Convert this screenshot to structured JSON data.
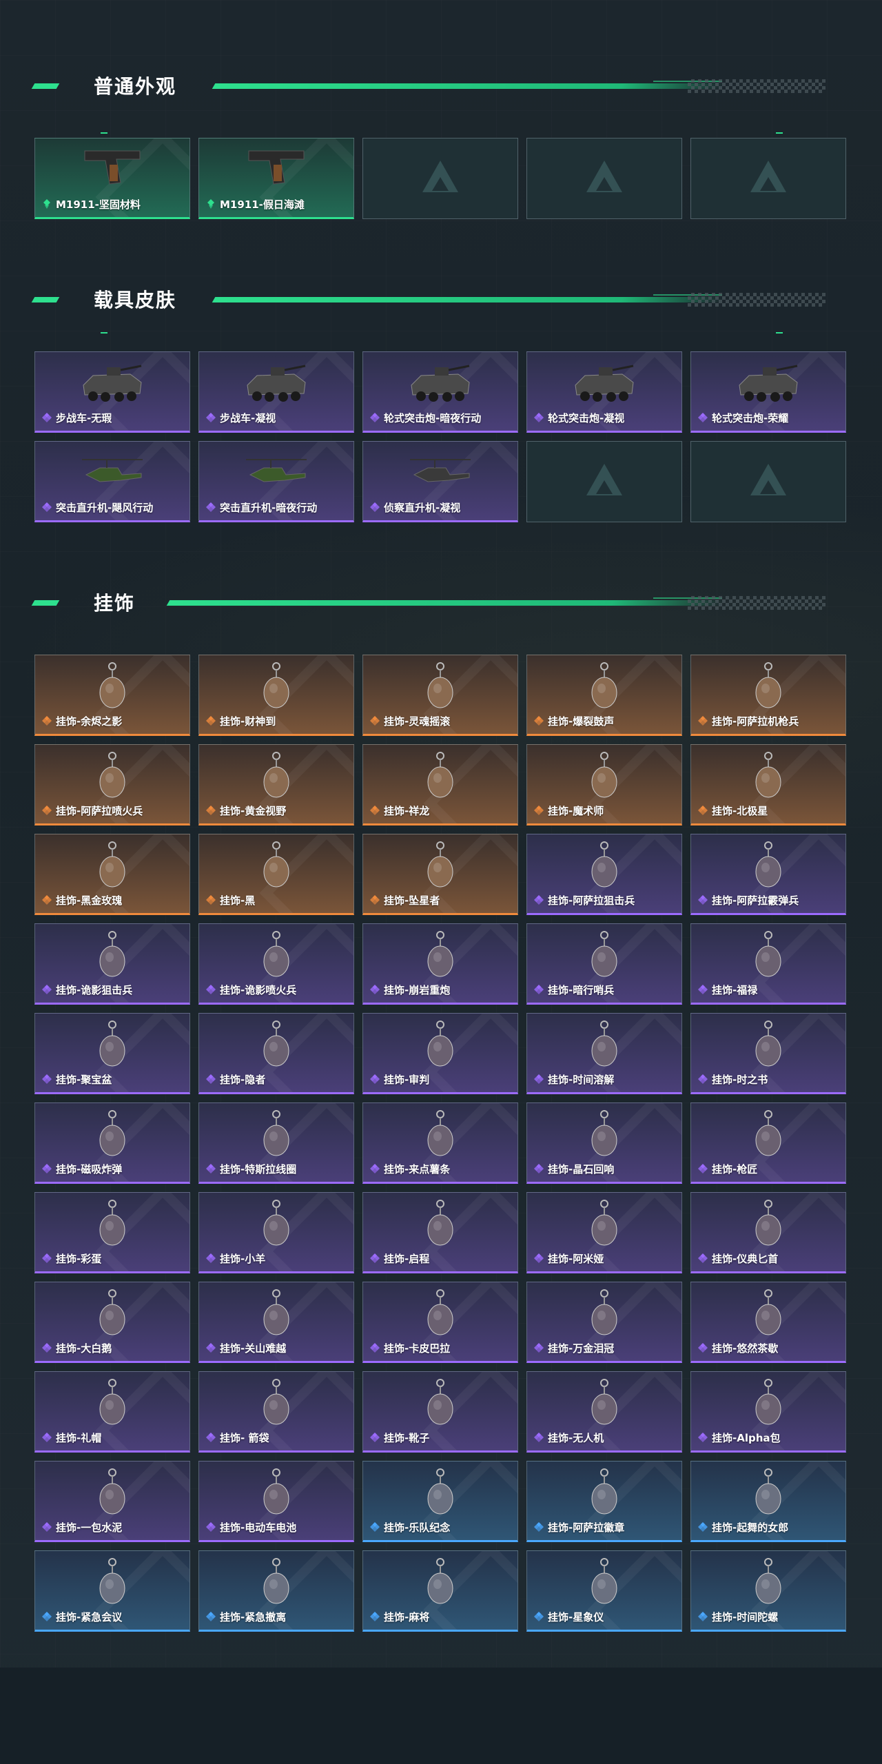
{
  "sections": [
    {
      "title": "普通外观",
      "items": [
        {
          "label": "M1911-坚固材料",
          "rarity": "green",
          "icon": "pistol-icon"
        },
        {
          "label": "M1911-假日海滩",
          "rarity": "green",
          "icon": "pistol-icon"
        },
        {
          "label": "",
          "rarity": "empty",
          "icon": "empty-slot-logo"
        },
        {
          "label": "",
          "rarity": "empty",
          "icon": "empty-slot-logo"
        },
        {
          "label": "",
          "rarity": "empty",
          "icon": "empty-slot-logo"
        }
      ]
    },
    {
      "title": "载具皮肤",
      "items": [
        {
          "label": "步战车-无瑕",
          "rarity": "purple",
          "icon": "ifv-icon"
        },
        {
          "label": "步战车-凝视",
          "rarity": "purple",
          "icon": "ifv-icon"
        },
        {
          "label": "轮式突击炮-暗夜行动",
          "rarity": "purple",
          "icon": "assault-gun-icon"
        },
        {
          "label": "轮式突击炮-凝视",
          "rarity": "purple",
          "icon": "assault-gun-icon"
        },
        {
          "label": "轮式突击炮-荣耀",
          "rarity": "purple",
          "icon": "assault-gun-icon"
        },
        {
          "label": "突击直升机-飓风行动",
          "rarity": "purple",
          "icon": "attack-helicopter-icon"
        },
        {
          "label": "突击直升机-暗夜行动",
          "rarity": "purple",
          "icon": "attack-helicopter-icon"
        },
        {
          "label": "侦察直升机-凝视",
          "rarity": "purple",
          "icon": "scout-helicopter-icon"
        },
        {
          "label": "",
          "rarity": "empty",
          "icon": "empty-slot-logo"
        },
        {
          "label": "",
          "rarity": "empty",
          "icon": "empty-slot-logo"
        }
      ]
    },
    {
      "title": "挂饰",
      "items": [
        {
          "label": "挂饰-余烬之影",
          "rarity": "orange",
          "icon": "charm-icon"
        },
        {
          "label": "挂饰-财神到",
          "rarity": "orange",
          "icon": "charm-icon"
        },
        {
          "label": "挂饰-灵魂摇滚",
          "rarity": "orange",
          "icon": "charm-icon"
        },
        {
          "label": "挂饰-爆裂鼓声",
          "rarity": "orange",
          "icon": "charm-icon"
        },
        {
          "label": "挂饰-阿萨拉机枪兵",
          "rarity": "orange",
          "icon": "charm-icon"
        },
        {
          "label": "挂饰-阿萨拉喷火兵",
          "rarity": "orange",
          "icon": "charm-icon"
        },
        {
          "label": "挂饰-黄金视野",
          "rarity": "orange",
          "icon": "charm-icon"
        },
        {
          "label": "挂饰-祥龙",
          "rarity": "orange",
          "icon": "charm-icon"
        },
        {
          "label": "挂饰-魔术师",
          "rarity": "orange",
          "icon": "charm-icon"
        },
        {
          "label": "挂饰-北极星",
          "rarity": "orange",
          "icon": "charm-icon"
        },
        {
          "label": "挂饰-黑金玫瑰",
          "rarity": "orange",
          "icon": "charm-icon"
        },
        {
          "label": "挂饰-黑",
          "rarity": "orange",
          "icon": "charm-icon"
        },
        {
          "label": "挂饰-坠星者",
          "rarity": "orange",
          "icon": "charm-icon"
        },
        {
          "label": "挂饰-阿萨拉狙击兵",
          "rarity": "purple",
          "icon": "charm-icon"
        },
        {
          "label": "挂饰-阿萨拉霰弹兵",
          "rarity": "purple",
          "icon": "charm-icon"
        },
        {
          "label": "挂饰-诡影狙击兵",
          "rarity": "purple",
          "icon": "charm-icon"
        },
        {
          "label": "挂饰-诡影喷火兵",
          "rarity": "purple",
          "icon": "charm-icon"
        },
        {
          "label": "挂饰-崩岩重炮",
          "rarity": "purple",
          "icon": "charm-icon"
        },
        {
          "label": "挂饰-暗行哨兵",
          "rarity": "purple",
          "icon": "charm-icon"
        },
        {
          "label": "挂饰-福禄",
          "rarity": "purple",
          "icon": "charm-icon"
        },
        {
          "label": "挂饰-聚宝盆",
          "rarity": "purple",
          "icon": "charm-icon"
        },
        {
          "label": "挂饰-隐者",
          "rarity": "purple",
          "icon": "charm-icon"
        },
        {
          "label": "挂饰-审判",
          "rarity": "purple",
          "icon": "charm-icon"
        },
        {
          "label": "挂饰-时间溶解",
          "rarity": "purple",
          "icon": "charm-icon"
        },
        {
          "label": "挂饰-时之书",
          "rarity": "purple",
          "icon": "charm-icon"
        },
        {
          "label": "挂饰-磁吸炸弹",
          "rarity": "purple",
          "icon": "charm-icon"
        },
        {
          "label": "挂饰-特斯拉线圈",
          "rarity": "purple",
          "icon": "charm-icon"
        },
        {
          "label": "挂饰-来点薯条",
          "rarity": "purple",
          "icon": "charm-icon"
        },
        {
          "label": "挂饰-晶石回响",
          "rarity": "purple",
          "icon": "charm-icon"
        },
        {
          "label": "挂饰-枪匠",
          "rarity": "purple",
          "icon": "charm-icon"
        },
        {
          "label": "挂饰-彩蛋",
          "rarity": "purple",
          "icon": "charm-icon"
        },
        {
          "label": "挂饰-小羊",
          "rarity": "purple",
          "icon": "charm-icon"
        },
        {
          "label": "挂饰-启程",
          "rarity": "purple",
          "icon": "charm-icon"
        },
        {
          "label": "挂饰-阿米娅",
          "rarity": "purple",
          "icon": "charm-icon"
        },
        {
          "label": "挂饰-仪典匕首",
          "rarity": "purple",
          "icon": "charm-icon"
        },
        {
          "label": "挂饰-大白鹅",
          "rarity": "purple",
          "icon": "charm-icon"
        },
        {
          "label": "挂饰-关山难越",
          "rarity": "purple",
          "icon": "charm-icon"
        },
        {
          "label": "挂饰-卡皮巴拉",
          "rarity": "purple",
          "icon": "charm-icon"
        },
        {
          "label": "挂饰-万金泪冠",
          "rarity": "purple",
          "icon": "charm-icon"
        },
        {
          "label": "挂饰-悠然茶歇",
          "rarity": "purple",
          "icon": "charm-icon"
        },
        {
          "label": "挂饰-礼帽",
          "rarity": "purple",
          "icon": "charm-icon"
        },
        {
          "label": "挂饰- 箭袋",
          "rarity": "purple",
          "icon": "charm-icon"
        },
        {
          "label": "挂饰-靴子",
          "rarity": "purple",
          "icon": "charm-icon"
        },
        {
          "label": "挂饰-无人机",
          "rarity": "purple",
          "icon": "charm-icon"
        },
        {
          "label": "挂饰-Alpha包",
          "rarity": "purple",
          "icon": "charm-icon"
        },
        {
          "label": "挂饰-一包水泥",
          "rarity": "purple",
          "icon": "charm-icon"
        },
        {
          "label": "挂饰-电动车电池",
          "rarity": "purple",
          "icon": "charm-icon"
        },
        {
          "label": "挂饰-乐队纪念",
          "rarity": "blue",
          "icon": "charm-icon"
        },
        {
          "label": "挂饰-阿萨拉徽章",
          "rarity": "blue",
          "icon": "charm-icon"
        },
        {
          "label": "挂饰-起舞的女郎",
          "rarity": "blue",
          "icon": "charm-icon"
        },
        {
          "label": "挂饰-紧急会议",
          "rarity": "blue",
          "icon": "charm-icon"
        },
        {
          "label": "挂饰-紧急撤离",
          "rarity": "blue",
          "icon": "charm-icon"
        },
        {
          "label": "挂饰-麻将",
          "rarity": "blue",
          "icon": "charm-icon"
        },
        {
          "label": "挂饰-星象仪",
          "rarity": "blue",
          "icon": "charm-icon"
        },
        {
          "label": "挂饰-时间陀螺",
          "rarity": "blue",
          "icon": "charm-icon"
        }
      ]
    }
  ],
  "colors": {
    "accent": "#2ee08e",
    "rarity_green": "#2ee08e",
    "rarity_purple": "#9c6bff",
    "rarity_orange": "#f08a3c",
    "rarity_blue": "#4aa8ff"
  }
}
